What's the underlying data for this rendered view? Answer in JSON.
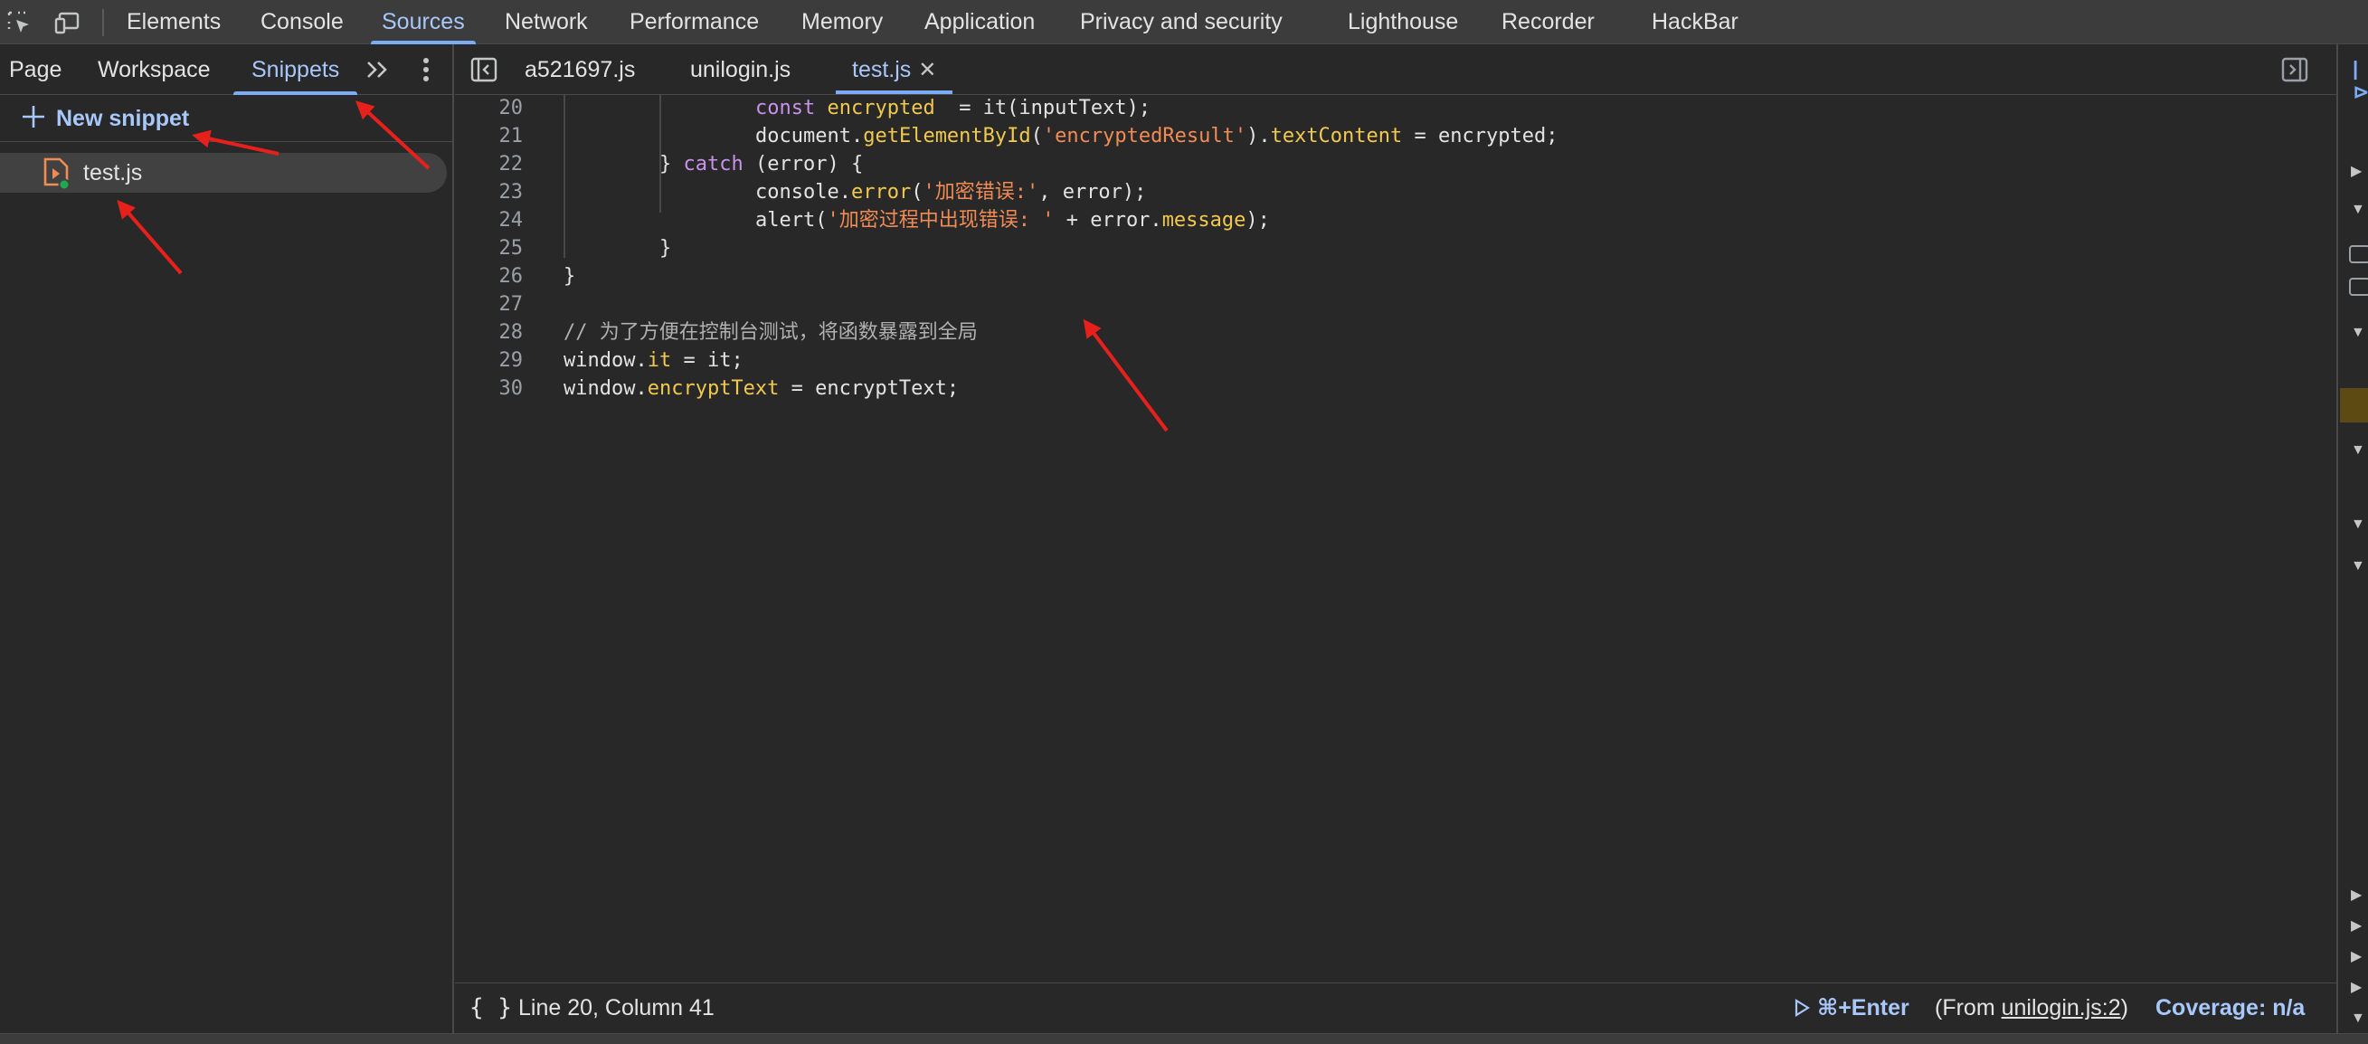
{
  "toolbar": {
    "tabs": [
      {
        "label": "Elements",
        "active": false
      },
      {
        "label": "Console",
        "active": false
      },
      {
        "label": "Sources",
        "active": true
      },
      {
        "label": "Network",
        "active": false
      },
      {
        "label": "Performance",
        "active": false
      },
      {
        "label": "Memory",
        "active": false
      },
      {
        "label": "Application",
        "active": false
      },
      {
        "label": "Privacy and security",
        "active": false
      },
      {
        "label": "Lighthouse",
        "active": false
      },
      {
        "label": "Recorder",
        "active": false
      },
      {
        "label": "HackBar",
        "active": false
      }
    ],
    "icons": [
      "inspect-element-icon",
      "device-toolbar-icon"
    ]
  },
  "navigator": {
    "tabs": [
      {
        "label": "Page",
        "active": false
      },
      {
        "label": "Workspace",
        "active": false
      },
      {
        "label": "Snippets",
        "active": true
      }
    ],
    "new_snippet_label": "New snippet",
    "snippets": [
      {
        "name": "test.js",
        "selected": true
      }
    ]
  },
  "editor": {
    "tabs": [
      {
        "label": "a521697.js",
        "active": false
      },
      {
        "label": "unilogin.js",
        "active": false
      },
      {
        "label": "test.js",
        "active": true,
        "closable": true
      }
    ],
    "close_glyph": "✕",
    "lines": [
      {
        "n": "20",
        "indent": 2,
        "tokens": [
          [
            "k",
            "const "
          ],
          [
            "p",
            "encrypted"
          ],
          [
            "",
            "  = it(inputText);"
          ]
        ]
      },
      {
        "n": "21",
        "indent": 2,
        "tokens": [
          [
            "",
            "document."
          ],
          [
            "p",
            "getElementById"
          ],
          [
            "",
            "("
          ],
          [
            "s",
            "'encryptedResult'"
          ],
          [
            "",
            ")."
          ],
          [
            "p",
            "textContent"
          ],
          [
            "",
            " = encrypted;"
          ]
        ]
      },
      {
        "n": "22",
        "indent": 1,
        "tokens": [
          [
            "",
            "} "
          ],
          [
            "k",
            "catch"
          ],
          [
            "",
            " (error) {"
          ]
        ]
      },
      {
        "n": "23",
        "indent": 2,
        "tokens": [
          [
            "",
            "console."
          ],
          [
            "p",
            "error"
          ],
          [
            "",
            "("
          ],
          [
            "s",
            "'加密错误:'"
          ],
          [
            "",
            ", error);"
          ]
        ]
      },
      {
        "n": "24",
        "indent": 2,
        "tokens": [
          [
            "",
            "alert("
          ],
          [
            "s",
            "'加密过程中出现错误: '"
          ],
          [
            "",
            " + error."
          ],
          [
            "p",
            "message"
          ],
          [
            "",
            ");"
          ]
        ]
      },
      {
        "n": "25",
        "indent": 1,
        "tokens": [
          [
            "",
            "}"
          ]
        ]
      },
      {
        "n": "26",
        "indent": 0,
        "tokens": [
          [
            "",
            "}"
          ]
        ]
      },
      {
        "n": "27",
        "indent": 0,
        "tokens": []
      },
      {
        "n": "28",
        "indent": 0,
        "tokens": [
          [
            "c",
            "// 为了方便在控制台测试，将函数暴露到全局"
          ]
        ]
      },
      {
        "n": "29",
        "indent": 0,
        "tokens": [
          [
            "",
            "window."
          ],
          [
            "p",
            "it"
          ],
          [
            "",
            " = it;"
          ]
        ]
      },
      {
        "n": "30",
        "indent": 0,
        "tokens": [
          [
            "",
            "window."
          ],
          [
            "p",
            "encryptText"
          ],
          [
            "",
            " = encryptText;"
          ]
        ]
      }
    ]
  },
  "status": {
    "pretty_print": "{ }",
    "cursor": "Line 20, Column 41",
    "run_label": "⌘+Enter",
    "from_prefix": "(From ",
    "from_link": "unilogin.js:2",
    "from_suffix": ")",
    "coverage": "Coverage: n/a"
  },
  "colors": {
    "accent": "#a8c7fa",
    "tab_underline": "#7cacf8",
    "keyword": "#c792ea",
    "property": "#f2c94c",
    "string": "#f28b54",
    "annotation_arrow": "#e8201c"
  }
}
